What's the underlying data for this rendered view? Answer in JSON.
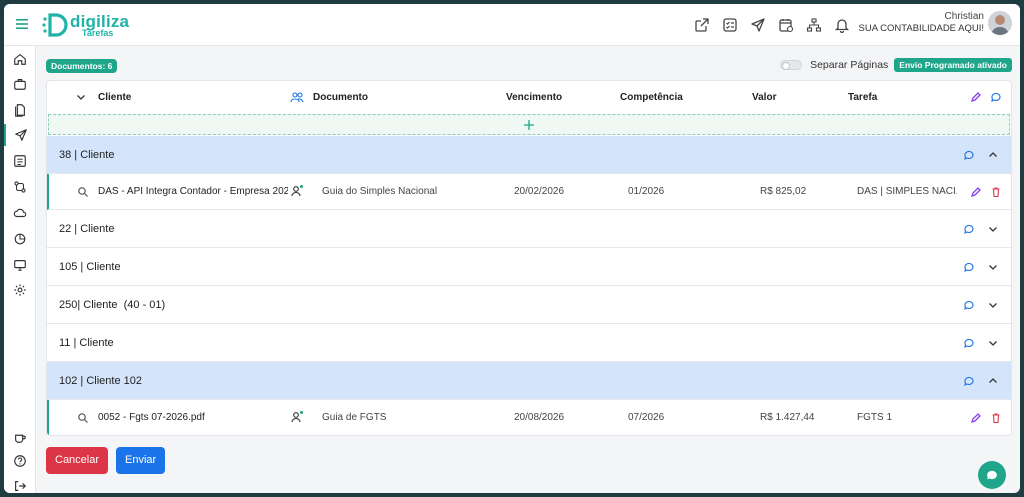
{
  "app": {
    "logo_name": "digiliza",
    "logo_sub": "Tarefas",
    "brand_color": "#1fb3a8",
    "accent_color": "#1fa589"
  },
  "user": {
    "name": "Christian",
    "company": "SUA CONTABILIDADE AQUI!"
  },
  "topbar_icons": [
    "external-link-icon",
    "checklist-icon",
    "send-icon",
    "calendar-doc-icon",
    "sitemap-icon",
    "bell-icon"
  ],
  "sidebar_icons": [
    "home-icon",
    "briefcase-icon",
    "documents-icon",
    "send-icon",
    "list-icon",
    "git-compare-icon",
    "cloud-icon",
    "analytics-icon",
    "monitor-icon",
    "settings-icon",
    "coffee-icon",
    "help-icon",
    "logout-icon"
  ],
  "header": {
    "docs_badge": "Documentos: 6",
    "toggle_label": "Separar Páginas",
    "envio_badge": "Envio Programado ativado"
  },
  "table": {
    "columns": [
      "Cliente",
      "Documento",
      "Vencimento",
      "Competência",
      "Valor",
      "Tarefa"
    ],
    "groups": [
      {
        "label": "38 | Cliente",
        "expanded": true,
        "docs": [
          {
            "cliente": "DAS - API Integra Contador - Empresa 202 - ...",
            "documento": "Guia do Simples Nacional",
            "vencimento": "20/02/2026",
            "competencia": "01/2026",
            "valor": "R$ 825,02",
            "tarefa": "DAS | SIMPLES NACI..."
          }
        ]
      },
      {
        "label": "22 | Cliente",
        "expanded": false,
        "docs": []
      },
      {
        "label": "105 | Cliente",
        "expanded": false,
        "docs": []
      },
      {
        "label": "250| Cliente  (40 - 01)",
        "expanded": false,
        "docs": []
      },
      {
        "label": "11 | Cliente",
        "expanded": false,
        "docs": []
      },
      {
        "label": "102 | Cliente 102",
        "expanded": true,
        "docs": [
          {
            "cliente": "0052 - Fgts 07-2026.pdf",
            "documento": "Guia de FGTS",
            "vencimento": "20/08/2026",
            "competencia": "07/2026",
            "valor": "R$ 1.427,44",
            "tarefa": "FGTS 1"
          }
        ]
      }
    ]
  },
  "actions": {
    "cancel_label": "Cancelar",
    "send_label": "Enviar"
  }
}
